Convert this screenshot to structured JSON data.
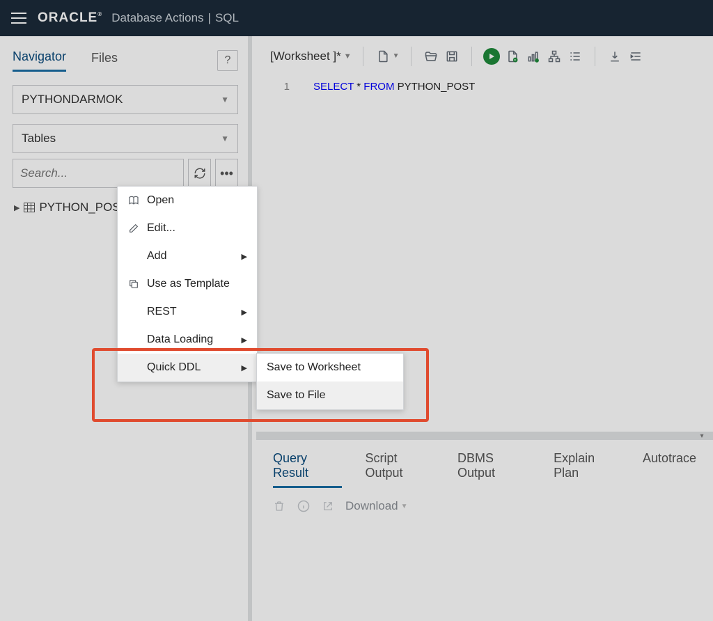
{
  "topbar": {
    "brand": "ORACLE",
    "area": "Database Actions",
    "page": "SQL"
  },
  "sidebar": {
    "tabs": {
      "navigator": "Navigator",
      "files": "Files"
    },
    "schema": "PYTHONDARMOK",
    "object_type": "Tables",
    "search_placeholder": "Search...",
    "tree_item": "PYTHON_POST"
  },
  "toolbar": {
    "worksheet_label": "[Worksheet ]*"
  },
  "editor": {
    "line_no": "1",
    "kw_select": "SELECT",
    "kw_from": "FROM",
    "star": "*",
    "ident": "PYTHON_POST"
  },
  "results": {
    "tabs": {
      "query": "Query Result",
      "script": "Script Output",
      "dbms": "DBMS Output",
      "explain": "Explain Plan",
      "autotrace": "Autotrace"
    },
    "download": "Download"
  },
  "ctx": {
    "open": "Open",
    "edit": "Edit...",
    "add": "Add",
    "use_tpl": "Use as Template",
    "rest": "REST",
    "data_loading": "Data Loading",
    "quick_ddl": "Quick DDL"
  },
  "submenu": {
    "save_ws": "Save to Worksheet",
    "save_file": "Save to File"
  }
}
